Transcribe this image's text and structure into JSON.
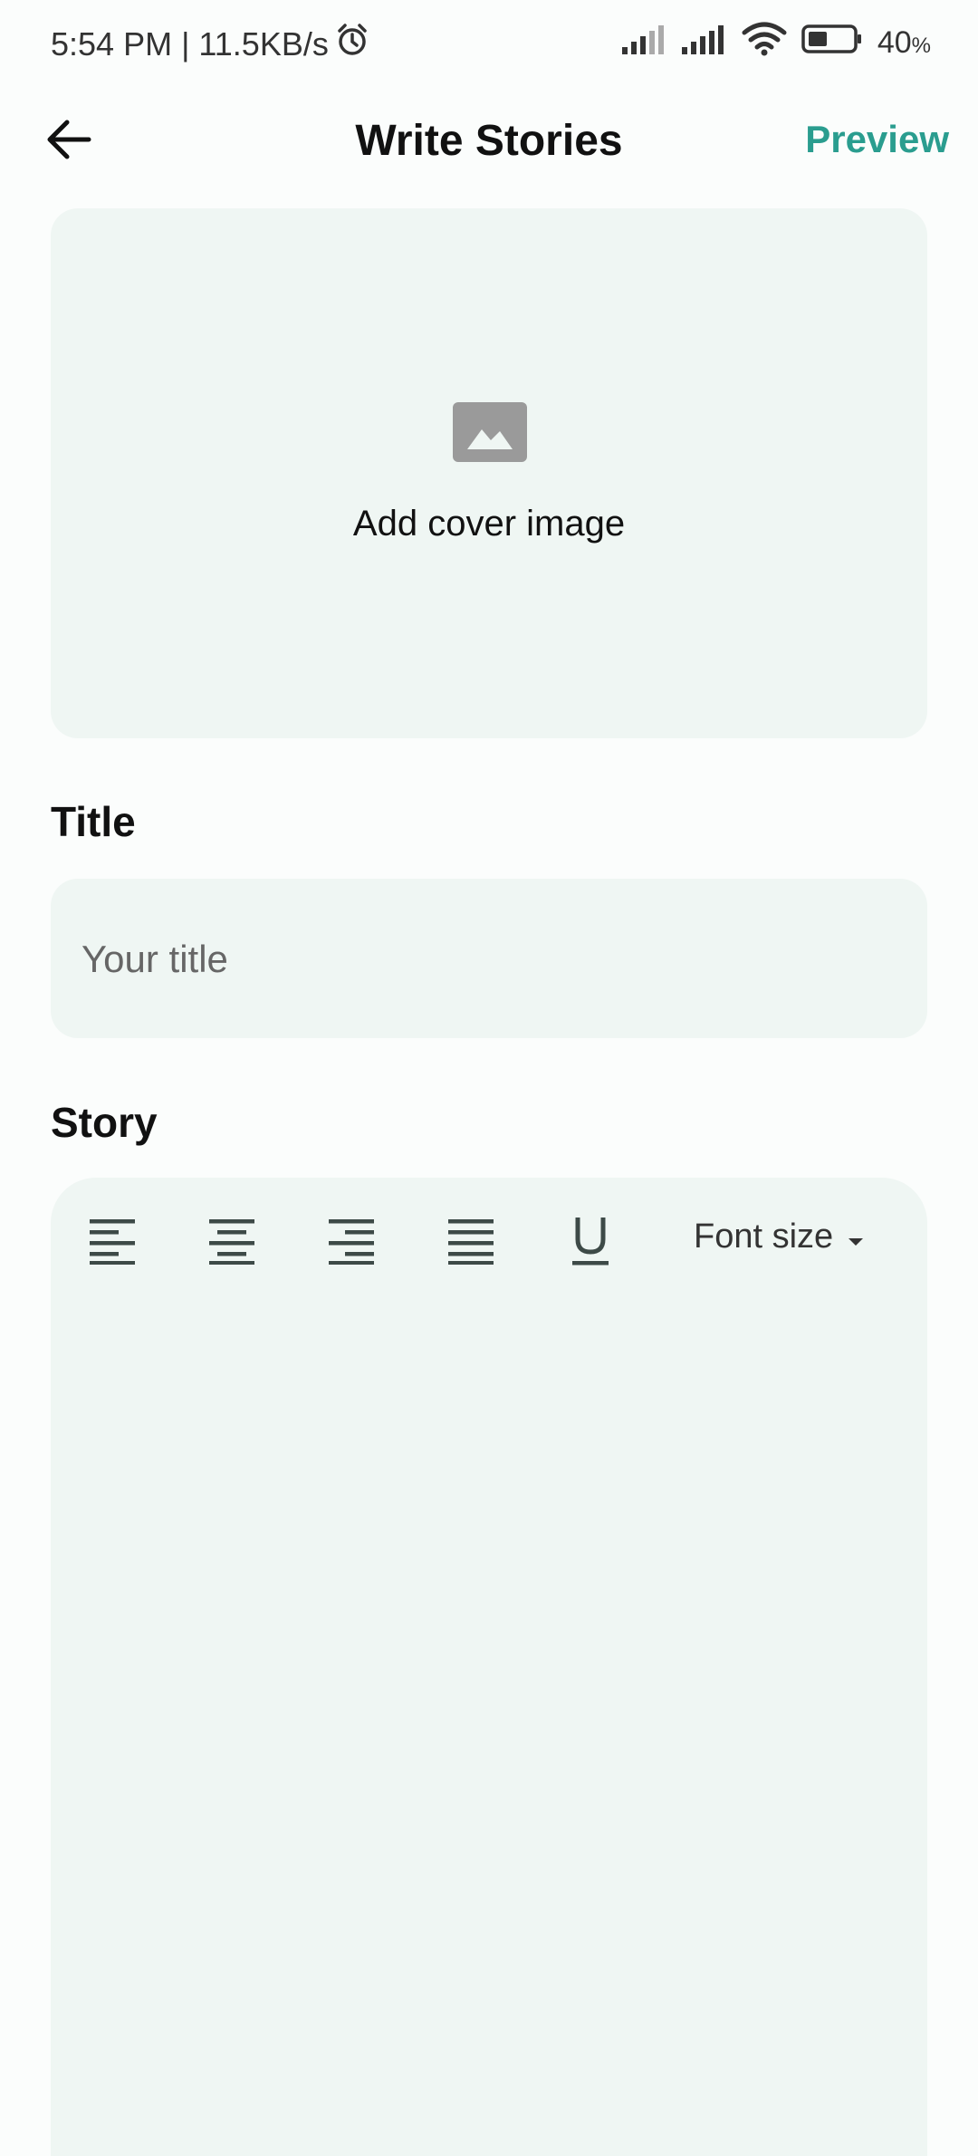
{
  "status_bar": {
    "time_speed": "5:54 PM | 11.5KB/s",
    "battery": "40",
    "battery_unit": "%"
  },
  "header": {
    "title": "Write Stories",
    "preview_label": "Preview"
  },
  "cover": {
    "label": "Add cover image"
  },
  "title_section": {
    "label": "Title",
    "placeholder": "Your title",
    "value": ""
  },
  "story_section": {
    "label": "Story",
    "font_size_label": "Font size",
    "value": ""
  },
  "icons": {
    "back": "arrow-left-icon",
    "cover": "image-icon",
    "align_left": "align-left-icon",
    "align_center": "align-center-icon",
    "align_right": "align-right-icon",
    "align_justify": "align-justify-icon",
    "underline": "underline-icon",
    "dropdown": "caret-down-icon"
  },
  "colors": {
    "accent": "#2a9d8f",
    "surface": "#eff6f3",
    "background": "#fbfdfc"
  }
}
